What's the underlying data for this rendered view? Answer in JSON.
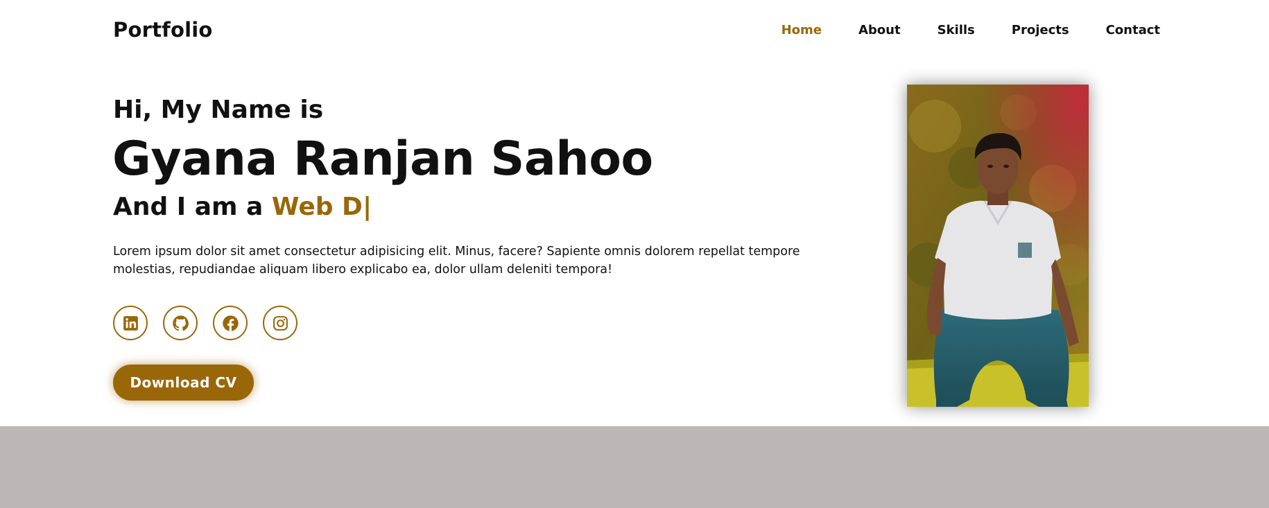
{
  "brand": "Portfolio",
  "nav": {
    "items": [
      {
        "label": "Home",
        "active": true
      },
      {
        "label": "About",
        "active": false
      },
      {
        "label": "Skills",
        "active": false
      },
      {
        "label": "Projects",
        "active": false
      },
      {
        "label": "Contact",
        "active": false
      }
    ]
  },
  "hero": {
    "greeting": "Hi, My Name is",
    "name": "Gyana Ranjan Sahoo",
    "role_prefix": "And I am a",
    "role_typed": "Web D",
    "cursor": "|",
    "intro": "Lorem ipsum dolor sit amet consectetur adipisicing elit. Minus, facere? Sapiente omnis dolorem repellat tempore molestias, repudiandae aliquam libero explicabo ea, dolor ullam deleniti tempora!",
    "socials": [
      {
        "icon": "linkedin-icon"
      },
      {
        "icon": "github-icon"
      },
      {
        "icon": "facebook-icon"
      },
      {
        "icon": "instagram-icon"
      }
    ],
    "cv_button": "Download CV"
  },
  "colors": {
    "accent": "#9a6708",
    "text": "#111111",
    "background": "#ffffff",
    "lower_section": "#bbb7b6"
  }
}
